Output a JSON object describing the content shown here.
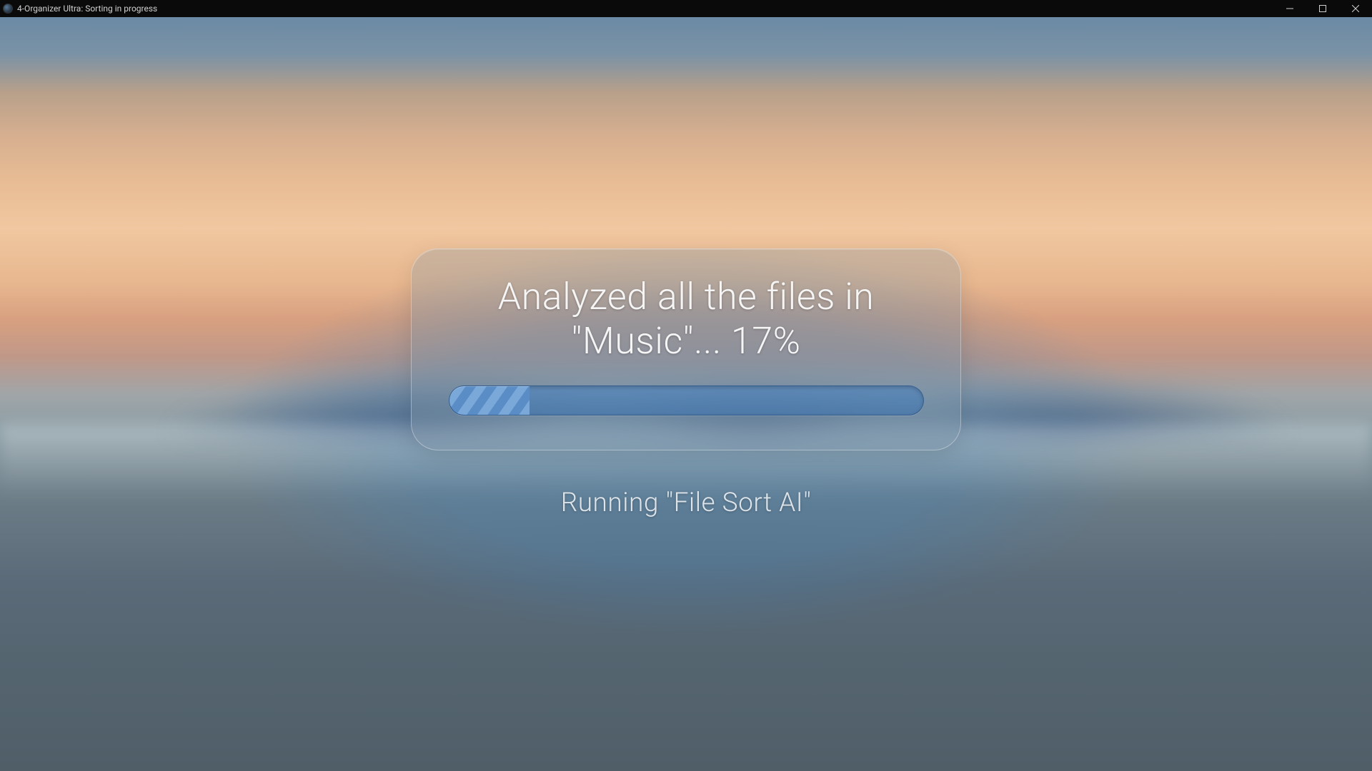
{
  "window": {
    "title": "4-Organizer Ultra: Sorting in progress"
  },
  "progress": {
    "status_line1": "Analyzed all the files in",
    "status_line2": "\"Music\"... 17%",
    "percent": 17,
    "subtitle": "Running \"File Sort AI\""
  }
}
